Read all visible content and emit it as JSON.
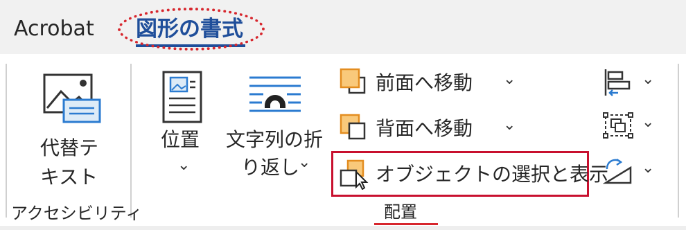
{
  "tabs": {
    "acrobat": "Acrobat",
    "shape_format": "図形の書式"
  },
  "accessibility": {
    "alt_text_line1": "代替テ",
    "alt_text_line2": "キスト",
    "group_label": "アクセシビリティ"
  },
  "arrange": {
    "position_label": "位置",
    "wrap_text_line1": "文字列の折",
    "wrap_text_line2": "り返し",
    "bring_forward": "前面へ移動",
    "send_backward": "背面へ移動",
    "selection_pane": "オブジェクトの選択と表示",
    "group_label": "配置"
  },
  "icons": {
    "alt_text": "alt-text-icon",
    "position": "position-icon",
    "wrap_text": "wrap-text-icon",
    "bring_forward": "bring-forward-icon",
    "send_backward": "send-backward-icon",
    "selection_pane": "selection-pane-icon",
    "align": "align-icon",
    "group": "group-icon",
    "rotate": "rotate-icon",
    "chevron": "chevron-down-icon"
  },
  "colors": {
    "accent_tab": "#1f4e9a",
    "highlight_red": "#d7262d",
    "shape_orange_fill": "#f9c97b",
    "shape_orange_stroke": "#e38d20",
    "icon_blue": "#2b7bd0"
  }
}
